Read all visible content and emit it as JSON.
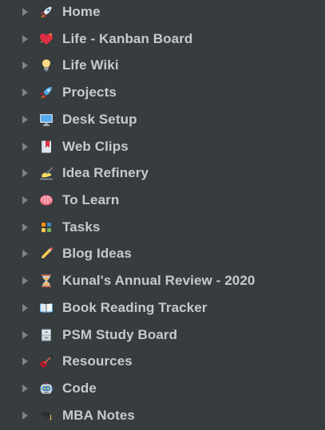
{
  "sidebar": {
    "items": [
      {
        "label": "Home",
        "icon": "rocket-icon"
      },
      {
        "label": "Life - Kanban Board",
        "icon": "sparkling-heart-icon"
      },
      {
        "label": "Life Wiki",
        "icon": "light-bulb-icon"
      },
      {
        "label": "Projects",
        "icon": "rocket-icon"
      },
      {
        "label": "Desk Setup",
        "icon": "desktop-computer-icon"
      },
      {
        "label": "Web Clips",
        "icon": "bookmark-icon"
      },
      {
        "label": "Idea Refinery",
        "icon": "writing-hand-icon"
      },
      {
        "label": "To Learn",
        "icon": "brain-icon"
      },
      {
        "label": "Tasks",
        "icon": "grid-icon"
      },
      {
        "label": "Blog Ideas",
        "icon": "pencil-icon"
      },
      {
        "label": "Kunal's Annual Review - 2020",
        "icon": "hourglass-icon"
      },
      {
        "label": "Book Reading Tracker",
        "icon": "open-book-icon"
      },
      {
        "label": "PSM Study Board",
        "icon": "file-cabinet-icon"
      },
      {
        "label": "Resources",
        "icon": "guitar-icon"
      },
      {
        "label": "Code",
        "icon": "robot-icon"
      },
      {
        "label": "MBA Notes",
        "icon": "graduation-cap-icon"
      }
    ]
  },
  "colors": {
    "background": "#373c3f",
    "text": "#c7c9ca",
    "chevron": "#7d8285"
  }
}
